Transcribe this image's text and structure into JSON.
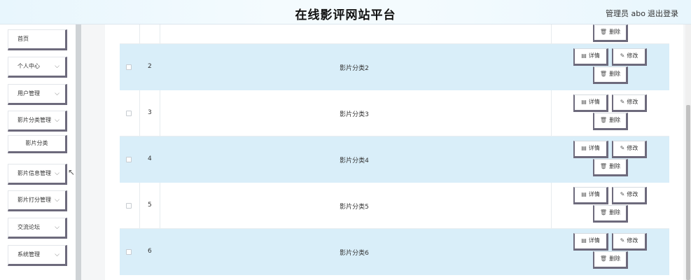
{
  "header": {
    "title": "在线影评网站平台",
    "user": "管理员 abo",
    "logout": "退出登录"
  },
  "sidebar": {
    "items": [
      {
        "label": "首页"
      },
      {
        "label": "个人中心"
      },
      {
        "label": "用户管理"
      },
      {
        "label": "影片分类管理"
      },
      {
        "label": "影片信息管理"
      },
      {
        "label": "影片打分管理"
      },
      {
        "label": "交流论坛"
      },
      {
        "label": "系统管理"
      }
    ],
    "sub_item": "影片分类",
    "chevron": "chevron-down-icon"
  },
  "table": {
    "rows": [
      {
        "index": "2",
        "name": "影片分类2"
      },
      {
        "index": "3",
        "name": "影片分类3"
      },
      {
        "index": "4",
        "name": "影片分类4"
      },
      {
        "index": "5",
        "name": "影片分类5"
      },
      {
        "index": "6",
        "name": "影片分类6"
      }
    ],
    "detail_label": "详情",
    "edit_label": "修改",
    "delete_label": "删除"
  },
  "colors": {
    "row_highlight": "#d9eef9",
    "button_border": "#6d6a7c"
  }
}
